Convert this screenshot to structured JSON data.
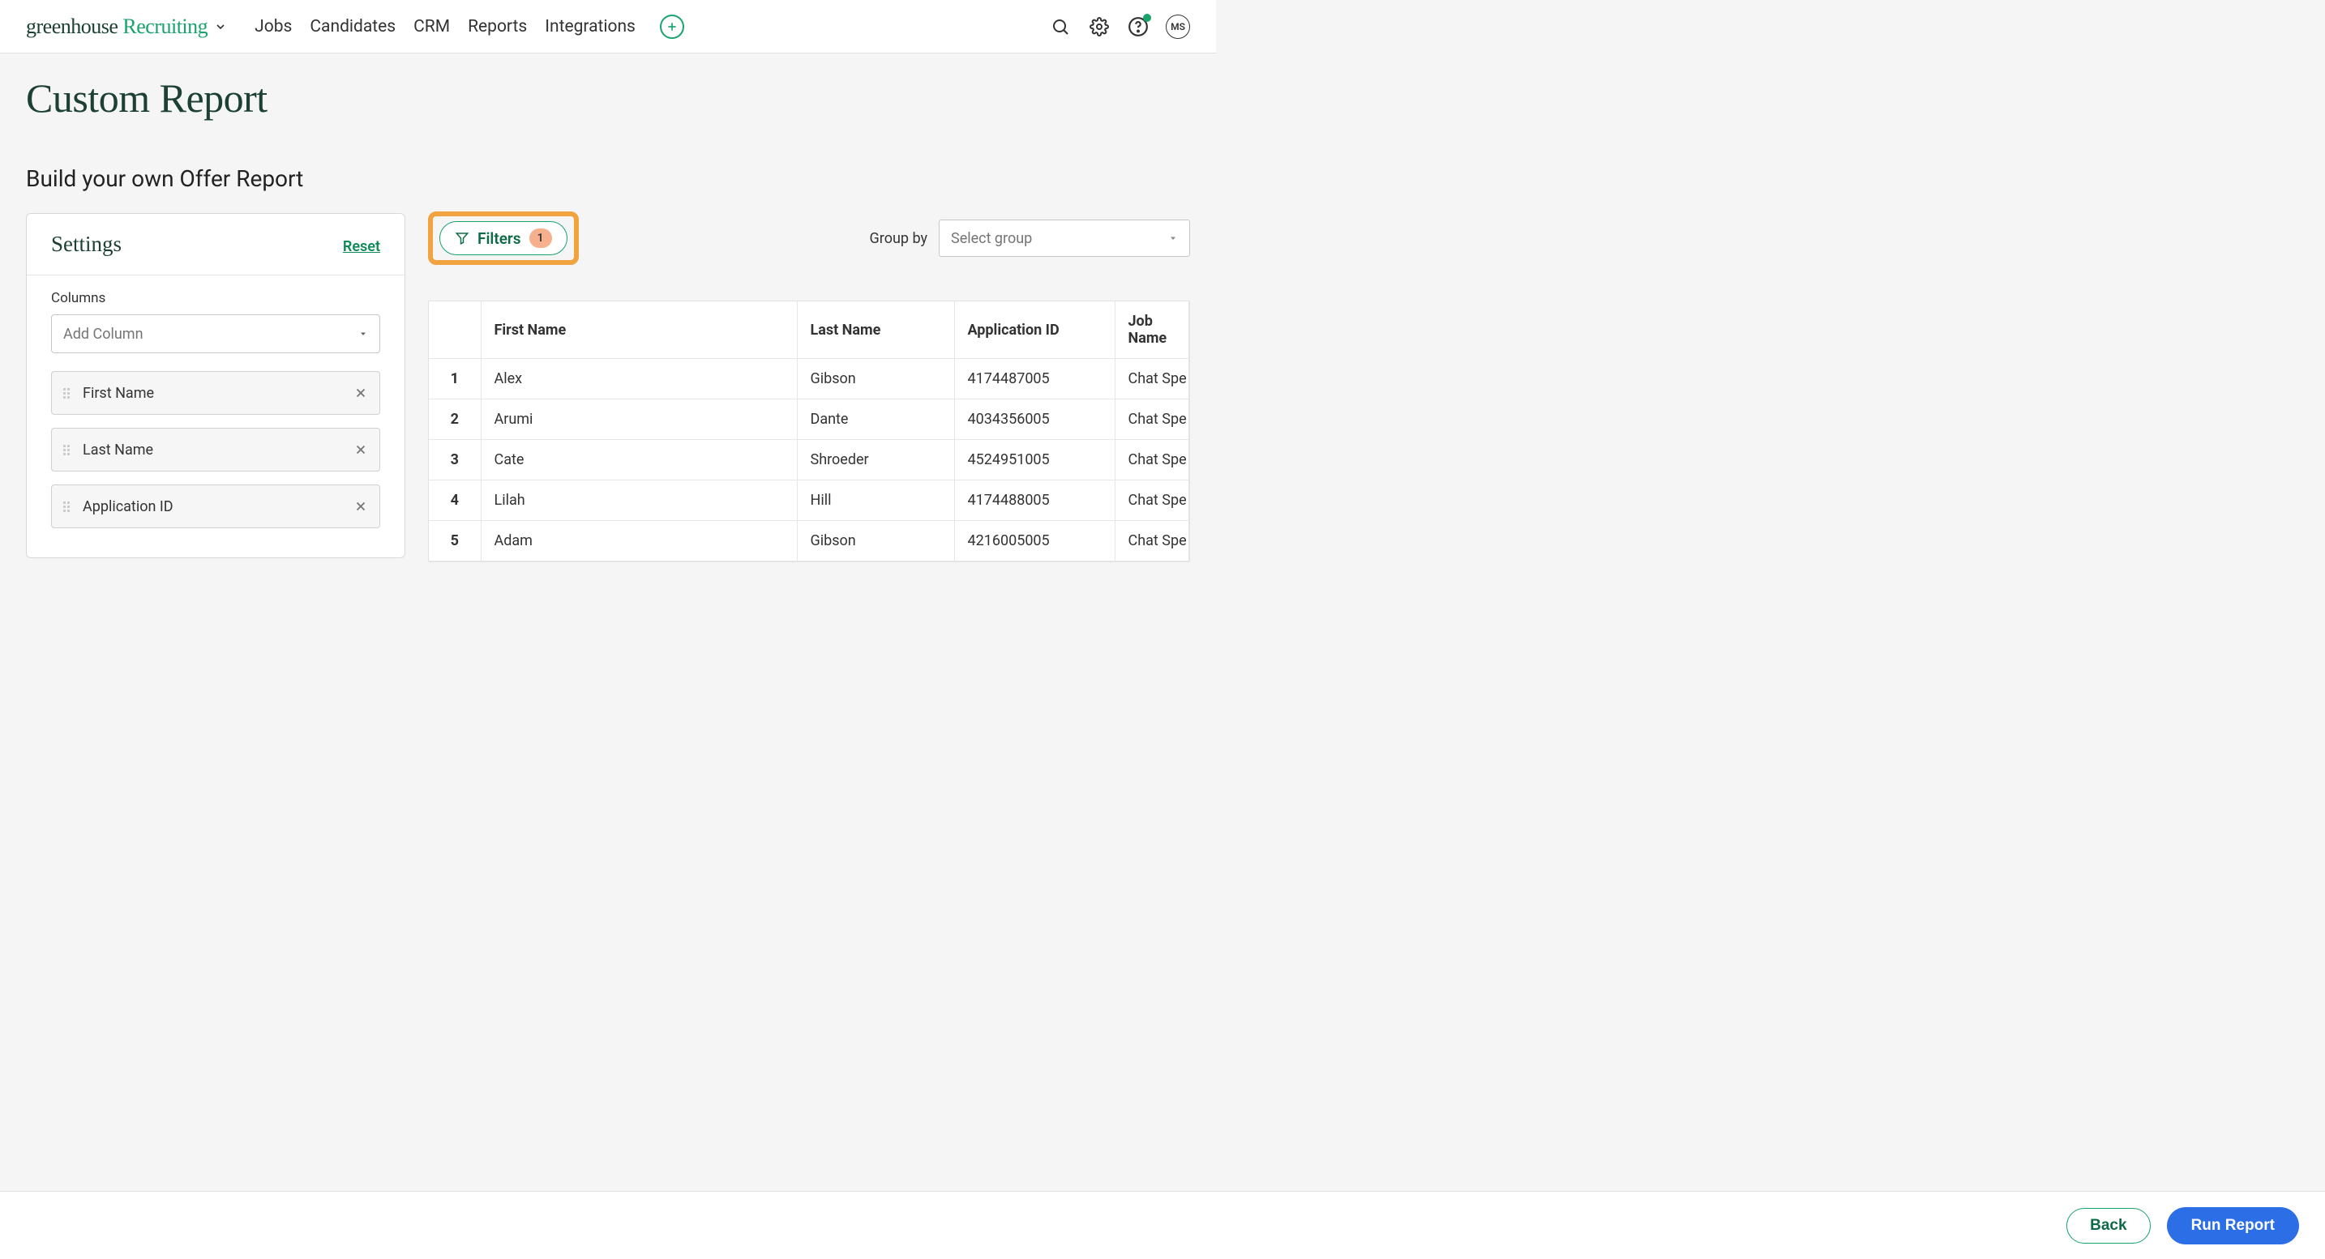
{
  "header": {
    "logo_word1": "greenhouse",
    "logo_word2": "Recruiting",
    "nav": [
      "Jobs",
      "Candidates",
      "CRM",
      "Reports",
      "Integrations"
    ],
    "avatar_initials": "MS"
  },
  "page": {
    "title": "Custom Report",
    "subtitle": "Build your own Offer Report"
  },
  "settings": {
    "heading": "Settings",
    "reset": "Reset",
    "columns_label": "Columns",
    "add_placeholder": "Add Column",
    "columns": [
      "First Name",
      "Last Name",
      "Application ID"
    ]
  },
  "filters": {
    "label": "Filters",
    "count": "1"
  },
  "groupby": {
    "label": "Group by",
    "placeholder": "Select group"
  },
  "table": {
    "headers": {
      "first": "First Name",
      "last": "Last Name",
      "app": "Application ID",
      "job": "Job Name"
    },
    "rows": [
      {
        "n": "1",
        "first": "Alex",
        "last": "Gibson",
        "app": "4174487005",
        "job": "Chat Spe"
      },
      {
        "n": "2",
        "first": "Arumi",
        "last": "Dante",
        "app": "4034356005",
        "job": "Chat Spe"
      },
      {
        "n": "3",
        "first": "Cate",
        "last": "Shroeder",
        "app": "4524951005",
        "job": "Chat Spe"
      },
      {
        "n": "4",
        "first": "Lilah",
        "last": "Hill",
        "app": "4174488005",
        "job": "Chat Spe"
      },
      {
        "n": "5",
        "first": "Adam",
        "last": "Gibson",
        "app": "4216005005",
        "job": "Chat Spe"
      }
    ]
  },
  "footer": {
    "back": "Back",
    "run": "Run Report"
  }
}
